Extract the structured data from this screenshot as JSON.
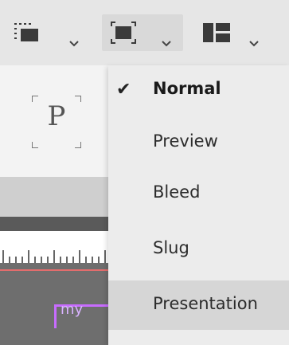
{
  "toolbar": {
    "buttons": [
      {
        "icon": "frame-grid-icon",
        "selected": false
      },
      {
        "icon": "screen-mode-icon",
        "selected": true
      },
      {
        "icon": "arrange-documents-icon",
        "selected": false
      }
    ]
  },
  "canvas": {
    "placeholder_char": "P",
    "frame_text": "my"
  },
  "screen_mode_menu": {
    "items": [
      {
        "label": "Normal",
        "checked": true
      },
      {
        "label": "Preview",
        "checked": false
      },
      {
        "label": "Bleed",
        "checked": false
      },
      {
        "label": "Slug",
        "checked": false
      },
      {
        "label": "Presentation",
        "checked": false,
        "hover": true
      }
    ]
  },
  "colors": {
    "frame_accent": "#c86cff",
    "guide_red": "#e26d6d"
  }
}
